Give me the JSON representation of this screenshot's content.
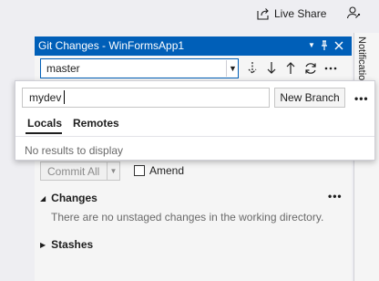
{
  "topbar": {
    "live_share_label": "Live Share",
    "live_share_icon": "share-arrow-icon",
    "feedback_icon": "feedback-person-icon"
  },
  "notifications": {
    "label": "Notificatio"
  },
  "tool_window": {
    "title": "Git Changes - WinFormsApp1",
    "title_bar_color": "#005fb8",
    "title_icons": [
      "dropdown-icon",
      "pin-icon",
      "close-icon"
    ],
    "branch_value": "master",
    "toolbar_icons": [
      "fetch-icon",
      "pull-icon",
      "push-icon",
      "sync-icon",
      "more-icon"
    ],
    "commit_all_label": "Commit All",
    "amend_label": "Amend",
    "amend_checked": false,
    "changes_label": "Changes",
    "changes_message": "There are no unstaged changes in the working directory.",
    "stashes_label": "Stashes"
  },
  "popup": {
    "input_value": "mydev",
    "new_branch_label": "New Branch",
    "tabs": [
      {
        "label": "Locals",
        "active": true
      },
      {
        "label": "Remotes",
        "active": false
      }
    ],
    "empty_message": "No results to display"
  }
}
